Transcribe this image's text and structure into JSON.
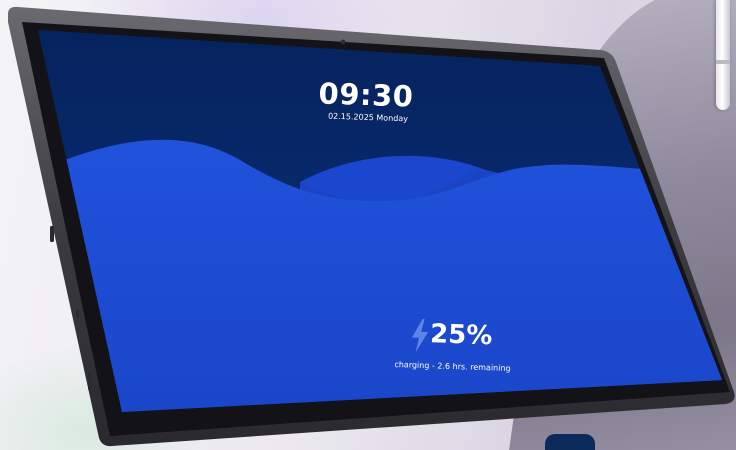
{
  "lockscreen": {
    "time": "09:30",
    "date": "02.15.2025 Monday",
    "battery_percent": "25%",
    "charging_status": "charging - 2.6 hrs. remaining"
  },
  "icons": {
    "charging": "lightning-bolt-icon",
    "camera": "front-camera-dot"
  },
  "colors": {
    "screen_dark": "#06205a",
    "wave_primary": "#1f4fd6",
    "wave_accent": "#1a44c4",
    "bezel": "#141418",
    "chassis": "#4a4a4f",
    "text": "#ffffff"
  }
}
